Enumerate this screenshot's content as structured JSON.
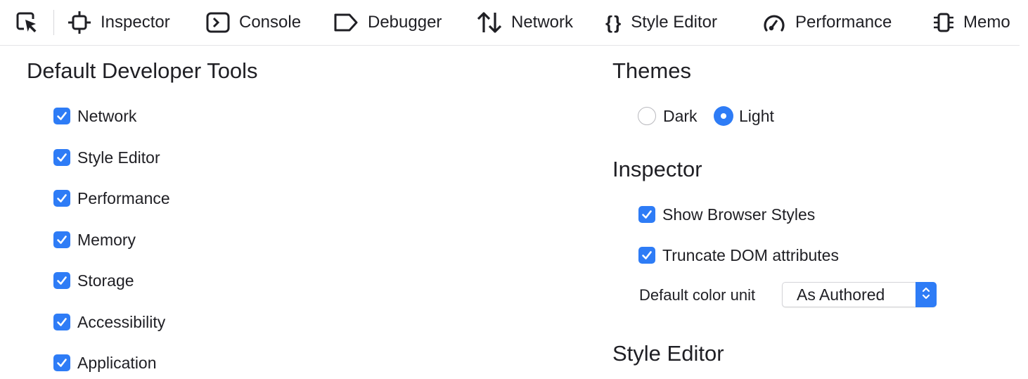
{
  "toolbar": {
    "picker_icon": "element-picker-icon",
    "tabs": [
      {
        "label": "Inspector",
        "icon": "inspector-icon"
      },
      {
        "label": "Console",
        "icon": "console-icon"
      },
      {
        "label": "Debugger",
        "icon": "debugger-icon"
      },
      {
        "label": "Network",
        "icon": "network-icon"
      },
      {
        "label": "Style Editor",
        "icon": "style-editor-icon"
      },
      {
        "label": "Performance",
        "icon": "performance-icon"
      },
      {
        "label": "Memo",
        "icon": "memory-icon"
      }
    ]
  },
  "default_tools": {
    "heading": "Default Developer Tools",
    "items": [
      {
        "label": "Network",
        "checked": true
      },
      {
        "label": "Style Editor",
        "checked": true
      },
      {
        "label": "Performance",
        "checked": true
      },
      {
        "label": "Memory",
        "checked": true
      },
      {
        "label": "Storage",
        "checked": true
      },
      {
        "label": "Accessibility",
        "checked": true
      },
      {
        "label": "Application",
        "checked": true
      }
    ]
  },
  "themes": {
    "heading": "Themes",
    "options": [
      {
        "label": "Dark",
        "selected": false
      },
      {
        "label": "Light",
        "selected": true
      }
    ]
  },
  "inspector": {
    "heading": "Inspector",
    "items": [
      {
        "label": "Show Browser Styles",
        "checked": true
      },
      {
        "label": "Truncate DOM attributes",
        "checked": true
      }
    ],
    "color_unit_label": "Default color unit",
    "color_unit_value": "As Authored"
  },
  "style_editor": {
    "heading": "Style Editor"
  },
  "colors": {
    "accent": "#2e7cf6",
    "text": "#1f1f24",
    "border": "#e4e4e7"
  }
}
